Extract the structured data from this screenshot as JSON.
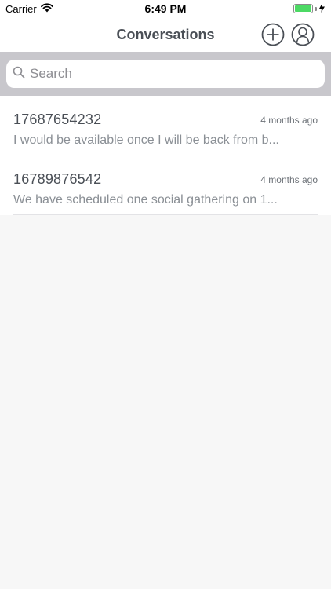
{
  "status_bar": {
    "carrier": "Carrier",
    "time": "6:49 PM",
    "battery_level": 1.0
  },
  "nav": {
    "title": "Conversations",
    "add_icon": "plus-circle-icon",
    "profile_icon": "user-circle-icon"
  },
  "search": {
    "placeholder": "Search",
    "value": "",
    "icon": "search-icon"
  },
  "conversations": [
    {
      "name": "17687654232",
      "time": "4 months ago",
      "preview": "I would be available once I will be back from b..."
    },
    {
      "name": "16789876542",
      "time": "4 months ago",
      "preview": "We have scheduled one social  gathering on 1..."
    }
  ],
  "colors": {
    "accent_text": "#4a4f56",
    "search_bg": "#c8c7cc",
    "battery": "#4cd964",
    "background": "#f7f7f7"
  }
}
